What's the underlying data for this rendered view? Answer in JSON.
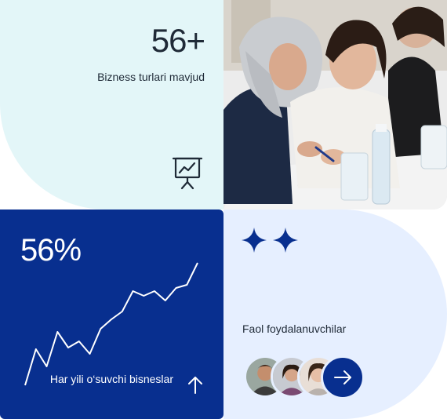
{
  "stats": {
    "business_types": {
      "value": "56+",
      "label": "Bizness turlari mavjud"
    },
    "growth": {
      "value": "56%",
      "label": "Har yili o‘suvchi bisneslar",
      "trend": [
        10,
        33,
        22,
        44,
        34,
        38,
        30,
        46,
        52,
        57,
        70,
        67,
        70,
        64,
        72,
        74,
        88
      ]
    },
    "users": {
      "label": "Faol foydalanuvchilar"
    }
  },
  "icons": {
    "business": "presentation-chart-icon",
    "growth": "arrow-up-icon",
    "users_action": "arrow-right-icon",
    "decoration": "sparkle-icon"
  },
  "colors": {
    "navy": "#082f8f",
    "mint": "#e3f6f8",
    "lavender": "#e6efff"
  }
}
